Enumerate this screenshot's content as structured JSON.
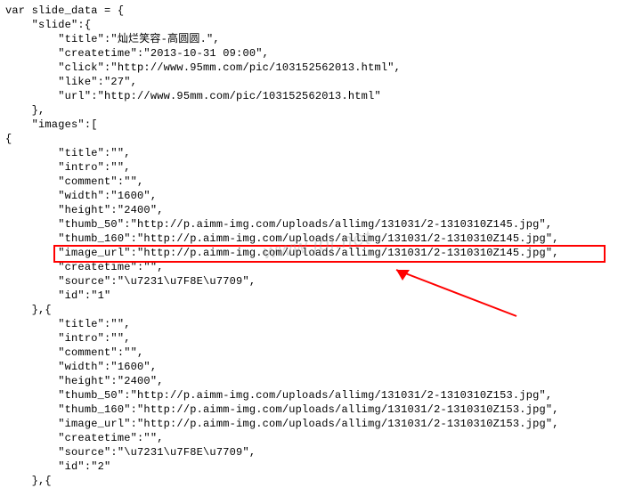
{
  "code": {
    "l01": "var slide_data = {",
    "l02": "    \"slide\":{",
    "l03": "        \"title\":\"灿烂笑容-高圆圆.\",",
    "l04": "        \"createtime\":\"2013-10-31 09:00\",",
    "l05": "        \"click\":\"http://www.95mm.com/pic/103152562013.html\",",
    "l06": "        \"like\":\"27\",",
    "l07": "        \"url\":\"http://www.95mm.com/pic/103152562013.html\"",
    "l08": "    },",
    "l09": "    \"images\":[",
    "l10": "{",
    "l11": "        \"title\":\"\",",
    "l12": "        \"intro\":\"\",",
    "l13": "        \"comment\":\"\",",
    "l14": "        \"width\":\"1600\",",
    "l15": "        \"height\":\"2400\",",
    "l16": "        \"thumb_50\":\"http://p.aimm-img.com/uploads/allimg/131031/2-1310310Z145.jpg\",",
    "l17": "        \"thumb_160\":\"http://p.aimm-img.com/uploads/allimg/131031/2-1310310Z145.jpg\",",
    "l18": "        \"image_url\":\"http://p.aimm-img.com/uploads/allimg/131031/2-1310310Z145.jpg\",",
    "l19": "        \"createtime\":\"\",",
    "l20": "        \"source\":\"\\u7231\\u7F8E\\u7709\",",
    "l21": "        \"id\":\"1\"",
    "l22": "    },{",
    "l23": "        \"title\":\"\",",
    "l24": "        \"intro\":\"\",",
    "l25": "        \"comment\":\"\",",
    "l26": "        \"width\":\"1600\",",
    "l27": "        \"height\":\"2400\",",
    "l28": "        \"thumb_50\":\"http://p.aimm-img.com/uploads/allimg/131031/2-1310310Z153.jpg\",",
    "l29": "        \"thumb_160\":\"http://p.aimm-img.com/uploads/allimg/131031/2-1310310Z153.jpg\",",
    "l30": "        \"image_url\":\"http://p.aimm-img.com/uploads/allimg/131031/2-1310310Z153.jpg\",",
    "l31": "        \"createtime\":\"\",",
    "l32": "        \"source\":\"\\u7231\\u7F8E\\u7709\",",
    "l33": "        \"id\":\"2\"",
    "l34": "    },{"
  },
  "annotation": {
    "highlighted_line_key": "image_url"
  }
}
